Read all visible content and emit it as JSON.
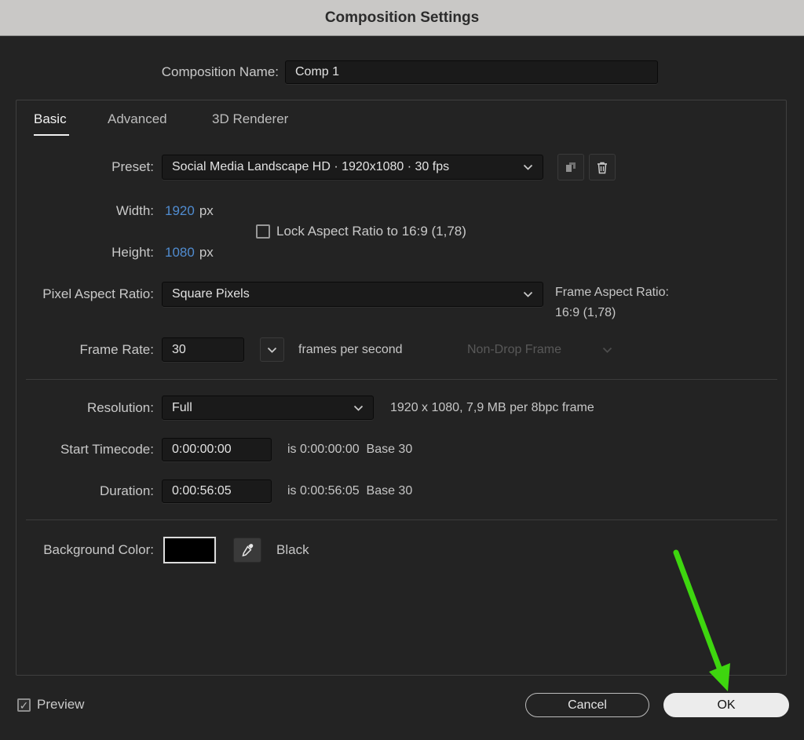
{
  "titlebar": {
    "title": "Composition Settings"
  },
  "name_row": {
    "label": "Composition Name:",
    "value": "Comp 1"
  },
  "tabs": [
    {
      "label": "Basic",
      "active": true
    },
    {
      "label": "Advanced",
      "active": false
    },
    {
      "label": "3D Renderer",
      "active": false
    }
  ],
  "preset": {
    "label": "Preset:",
    "value": "Social Media Landscape HD  ·  1920x1080 · 30 fps"
  },
  "dimensions": {
    "width_label": "Width:",
    "width_value": "1920",
    "width_unit": "px",
    "height_label": "Height:",
    "height_value": "1080",
    "height_unit": "px",
    "lock_label": "Lock Aspect Ratio to 16:9 (1,78)",
    "lock_checked": false
  },
  "pixel_aspect": {
    "label": "Pixel Aspect Ratio:",
    "value": "Square Pixels",
    "frame_aspect_label": "Frame Aspect Ratio:",
    "frame_aspect_value": "16:9 (1,78)"
  },
  "frame_rate": {
    "label": "Frame Rate:",
    "value": "30",
    "unit": "frames per second",
    "drop_frame_value": "Non-Drop Frame"
  },
  "resolution": {
    "label": "Resolution:",
    "value": "Full",
    "info": "1920 x 1080, 7,9 MB per 8bpc frame"
  },
  "start_timecode": {
    "label": "Start Timecode:",
    "value": "0:00:00:00",
    "info": "is 0:00:00:00  Base 30"
  },
  "duration": {
    "label": "Duration:",
    "value": "0:00:56:05",
    "info": "is 0:00:56:05  Base 30"
  },
  "background": {
    "label": "Background Color:",
    "color_hex": "#000000",
    "color_name": "Black"
  },
  "footer": {
    "preview_label": "Preview",
    "cancel_label": "Cancel",
    "ok_label": "OK"
  },
  "icons": {
    "check": "✓"
  },
  "colors": {
    "accent_blue": "#508cd0",
    "arrow_green": "#3ed60f",
    "titlebar_bg": "#c9c8c6"
  }
}
